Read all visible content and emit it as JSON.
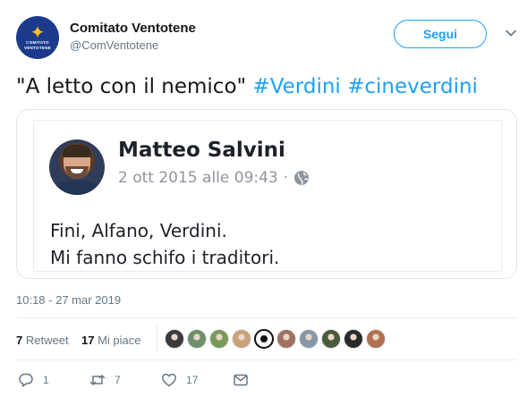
{
  "account": {
    "display_name": "Comitato Ventotene",
    "handle": "@ComVentotene",
    "follow_label": "Segui"
  },
  "tweet": {
    "text_quote": "\"A letto con il nemico\"",
    "hashtags": [
      "#Verdini",
      "#cineverdini"
    ],
    "timestamp": "10:18 - 27 mar 2019"
  },
  "embedded_post": {
    "author": "Matteo Salvini",
    "date": "2 ott 2015 alle 09:43",
    "separator": "·",
    "privacy_icon": "globe-icon",
    "lines": [
      "Fini, Alfano, Verdini.",
      "Mi fanno schifo i traditori."
    ]
  },
  "stats": {
    "retweets_count": "7",
    "retweets_label": "Retweet",
    "likes_count": "17",
    "likes_label": "Mi piace",
    "liker_avatars": [
      {
        "name": "liker-avatar-1",
        "color": "#3a3a3a"
      },
      {
        "name": "liker-avatar-2",
        "color": "#6f8f6a"
      },
      {
        "name": "liker-avatar-3",
        "color": "#7a9a5a"
      },
      {
        "name": "liker-avatar-4",
        "color": "#c9a27a"
      },
      {
        "name": "liker-avatar-5",
        "color": "#111111"
      },
      {
        "name": "liker-avatar-6",
        "color": "#a07060"
      },
      {
        "name": "liker-avatar-7",
        "color": "#8898a8"
      },
      {
        "name": "liker-avatar-8",
        "color": "#4a5a3a"
      },
      {
        "name": "liker-avatar-9",
        "color": "#2a2a2a"
      },
      {
        "name": "liker-avatar-10",
        "color": "#b07050"
      }
    ]
  },
  "actions": {
    "reply_count": "1",
    "retweet_count": "7",
    "like_count": "17"
  },
  "colors": {
    "accent": "#1da1f2",
    "text": "#14171a",
    "muted": "#657786",
    "fb_muted": "#90949c"
  }
}
